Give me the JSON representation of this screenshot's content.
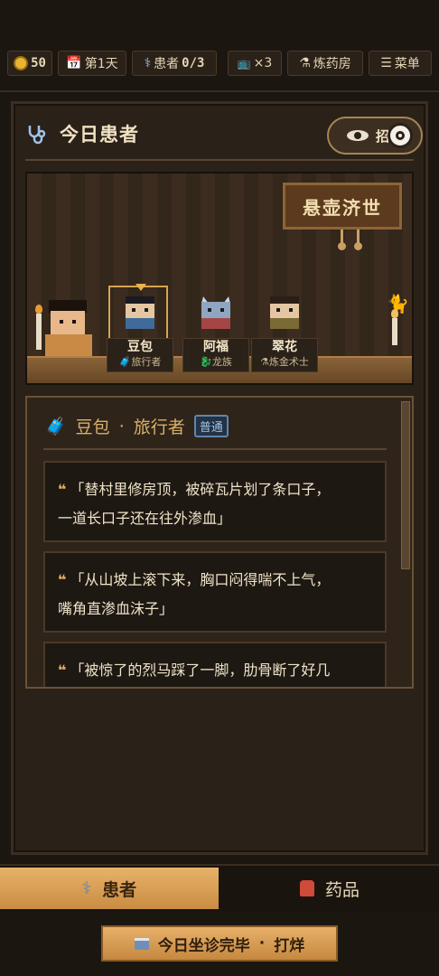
{
  "topbar": {
    "coins": "50",
    "day": "第1天",
    "patients": "患者",
    "patients_count": "0/3",
    "tv_count": "×3",
    "lab": "炼药房",
    "menu": "菜单"
  },
  "header": {
    "title": "今日患者",
    "recruit_label": "招揽"
  },
  "scene": {
    "sign": "悬壶济世",
    "patients": [
      {
        "name": "豆包",
        "type": "旅行者",
        "icon": "luggage-icon",
        "selected": true
      },
      {
        "name": "阿福",
        "type": "龙族",
        "icon": "dragon-icon",
        "selected": false
      },
      {
        "name": "翠花",
        "type": "炼金术士",
        "icon": "flask-icon",
        "selected": false
      }
    ]
  },
  "detail": {
    "name": "豆包",
    "separator": "·",
    "type": "旅行者",
    "badge": "普通",
    "quotes": [
      {
        "line1": "「替村里修房顶，被碎瓦片划了条口子，",
        "line2": "一道长口子还在往外渗血」"
      },
      {
        "line1": "「从山坡上滚下来，胸口闷得喘不上气，",
        "line2": "嘴角直渗血沫子」"
      },
      {
        "line1": "「被惊了的烈马踩了一脚，肋骨断了好几",
        "line2": ""
      }
    ]
  },
  "tabs": {
    "patients": "患者",
    "medicine": "药品"
  },
  "end_day": {
    "label": "今日坐诊完毕",
    "separator": "·",
    "action": "打烊"
  },
  "colors": {
    "accent": "#e4b25e",
    "panel": "#2a2119",
    "tab_active": "#e8b26a",
    "badge": "#5f88ae"
  }
}
